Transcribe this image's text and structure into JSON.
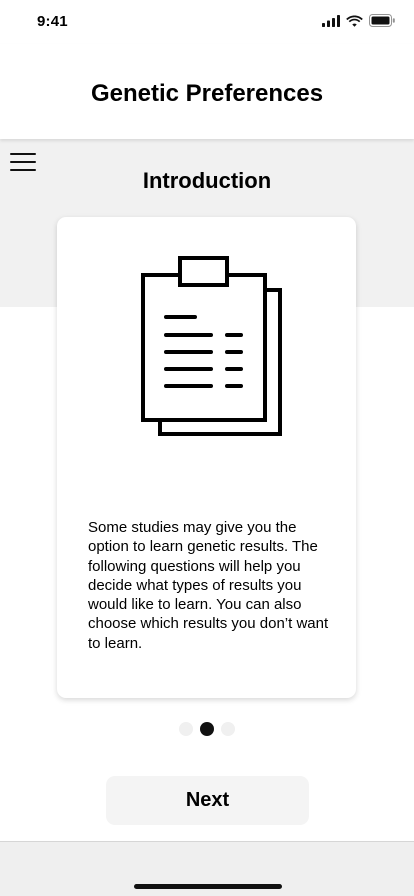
{
  "status_bar": {
    "time": "9:41",
    "icons": [
      "cellular-signal-icon",
      "wifi-icon",
      "battery-icon"
    ]
  },
  "header": {
    "title": "Genetic Preferences",
    "menu_icon": "hamburger-menu-icon"
  },
  "section": {
    "title": "Introduction"
  },
  "card": {
    "icon": "clipboard-document-icon",
    "body": "Some studies may give you the option to learn genetic results. The following questions will help you decide what types of results you would like to learn. You can also choose which results you don’t want to learn."
  },
  "pager": {
    "total": 3,
    "active_index": 1
  },
  "actions": {
    "next_label": "Next"
  },
  "colors": {
    "band_background": "#f1f1f1",
    "button_background": "#f4f4f4",
    "active_dot": "#111111",
    "inactive_dot": "#f0f0f0"
  }
}
